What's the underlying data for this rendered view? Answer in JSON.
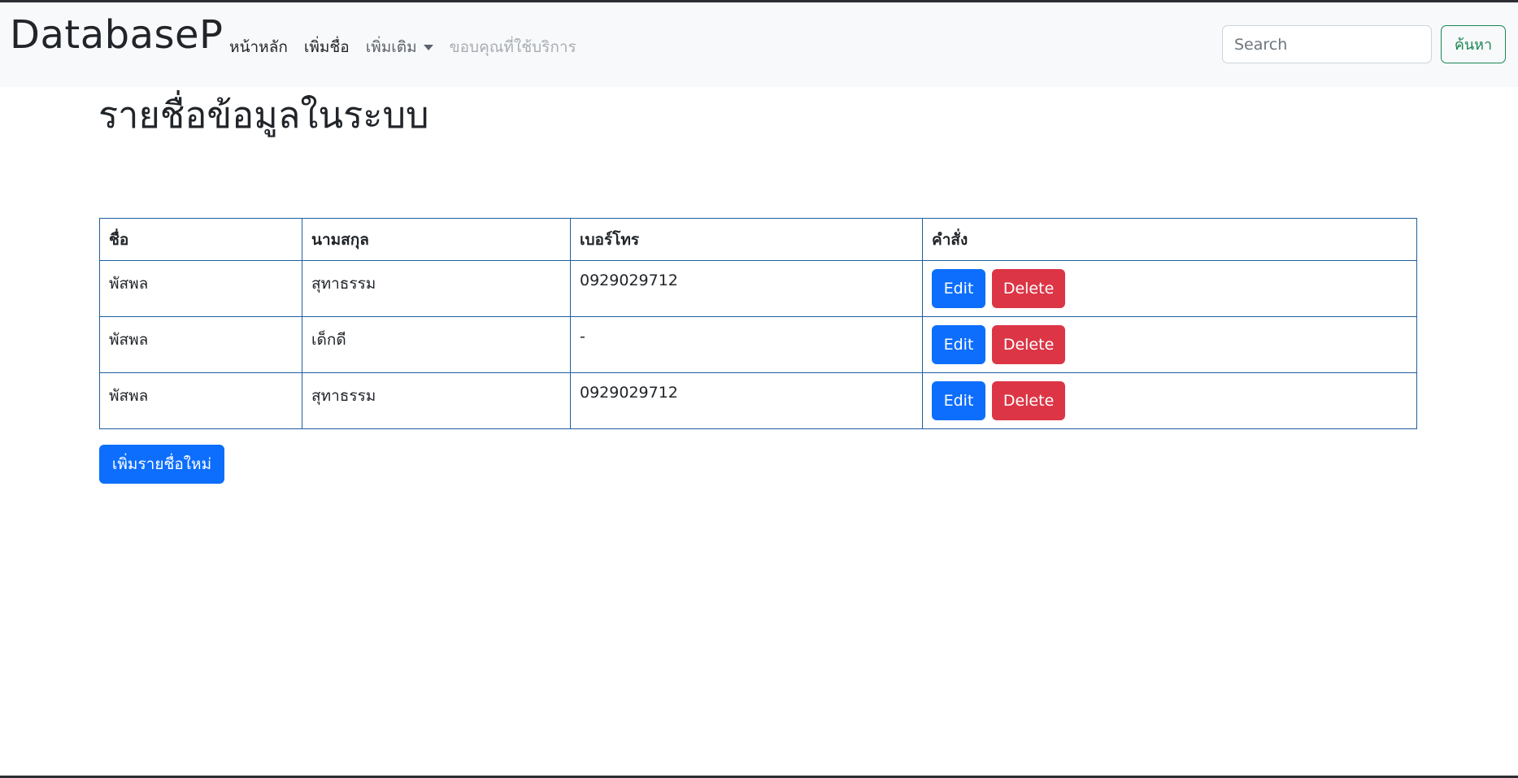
{
  "navbar": {
    "brand": "DatabaseP",
    "links": [
      {
        "label": "หน้าหลัก"
      },
      {
        "label": "เพิ่มชื่อ"
      },
      {
        "label": "เพิ่มเติม"
      },
      {
        "label": "ขอบคุณที่ใช้บริการ"
      }
    ],
    "search_placeholder": "Search",
    "search_value": "",
    "search_button": "ค้นหา"
  },
  "page": {
    "title": "รายชื่อข้อมูลในระบบ"
  },
  "table": {
    "headers": [
      "ชื่อ",
      "นามสกุล",
      "เบอร์โทร",
      "คำสั่ง"
    ],
    "rows": [
      {
        "first_name": "พัสพล",
        "last_name": "สุทาธรรม",
        "phone": "0929029712"
      },
      {
        "first_name": "พัสพล",
        "last_name": "เด็กดี",
        "phone": "-"
      },
      {
        "first_name": "พัสพล",
        "last_name": "สุทาธรรม",
        "phone": "0929029712"
      }
    ],
    "edit_label": "Edit",
    "delete_label": "Delete"
  },
  "add_button": "เพิ่มรายชื่อใหม่",
  "colors": {
    "primary": "#0d6efd",
    "danger": "#dc3545",
    "success": "#198754",
    "navbar_bg": "#f8f9fa",
    "table_border": "#1f5f9e"
  },
  "icons": {
    "dropdown": "chevron-down-icon"
  }
}
